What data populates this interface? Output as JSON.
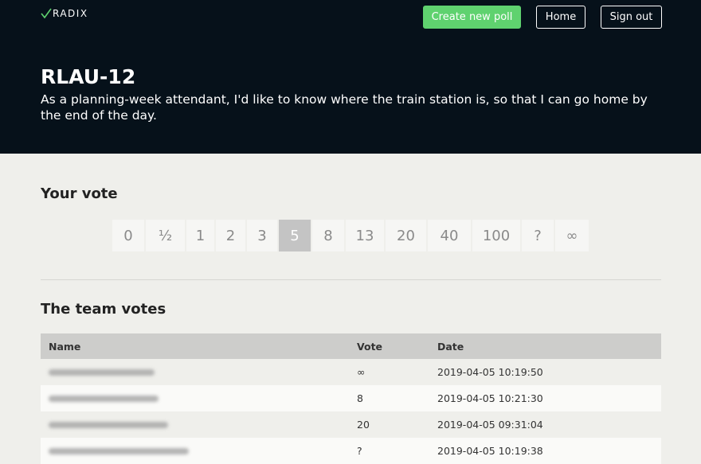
{
  "brand": {
    "logo_text": "RADIX"
  },
  "nav": {
    "create_poll": "Create new poll",
    "home": "Home",
    "sign_out": "Sign out"
  },
  "story": {
    "title": "RLAU-12",
    "description": "As a planning-week attendant, I'd like to know where the train station is, so that I can go home by the end of the day."
  },
  "your_vote": {
    "heading": "Your vote",
    "cards": [
      "0",
      "½",
      "1",
      "2",
      "3",
      "5",
      "8",
      "13",
      "20",
      "40",
      "100",
      "?",
      "∞"
    ],
    "selected": "5"
  },
  "team_votes": {
    "heading": "The team votes",
    "columns": {
      "name": "Name",
      "vote": "Vote",
      "date": "Date"
    },
    "rows": [
      {
        "vote": "∞",
        "date": "2019-04-05 10:19:50"
      },
      {
        "vote": "8",
        "date": "2019-04-05 10:21:30"
      },
      {
        "vote": "20",
        "date": "2019-04-05 09:31:04"
      },
      {
        "vote": "?",
        "date": "2019-04-05 10:19:38"
      }
    ]
  },
  "colors": {
    "header_bg": "#06111a",
    "primary": "#5fd26f",
    "page_bg": "#efefeb"
  }
}
